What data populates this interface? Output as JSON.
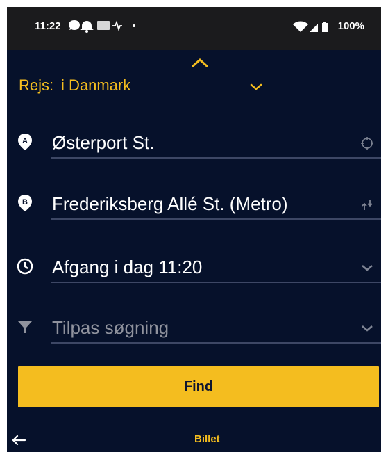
{
  "status_bar": {
    "time": "11:22",
    "battery": "100%",
    "left_icons": [
      "messenger-icon",
      "notification-icon",
      "cast-icon",
      "pulse-icon",
      "dot-icon"
    ],
    "right_icons": [
      "wifi-icon",
      "signal-icon",
      "battery-icon"
    ]
  },
  "travel_type": {
    "prefix": "Rejs:",
    "value": "i Danmark"
  },
  "from_field": {
    "icon": "A",
    "value": "Østerport St."
  },
  "to_field": {
    "icon": "B",
    "value": "Frederiksberg Allé St. (Metro)"
  },
  "time_field": {
    "value": "Afgang  i dag  11:20"
  },
  "filter_field": {
    "value": "Tilpas søgning"
  },
  "find_button": {
    "label": "Find"
  },
  "bottom_bar": {
    "label": "Billet"
  },
  "colors": {
    "background": "#06112b",
    "accent": "#f4bd1f",
    "status_bar": "#1b1b1d",
    "divider": "#3d4765",
    "placeholder": "#8f929d"
  }
}
